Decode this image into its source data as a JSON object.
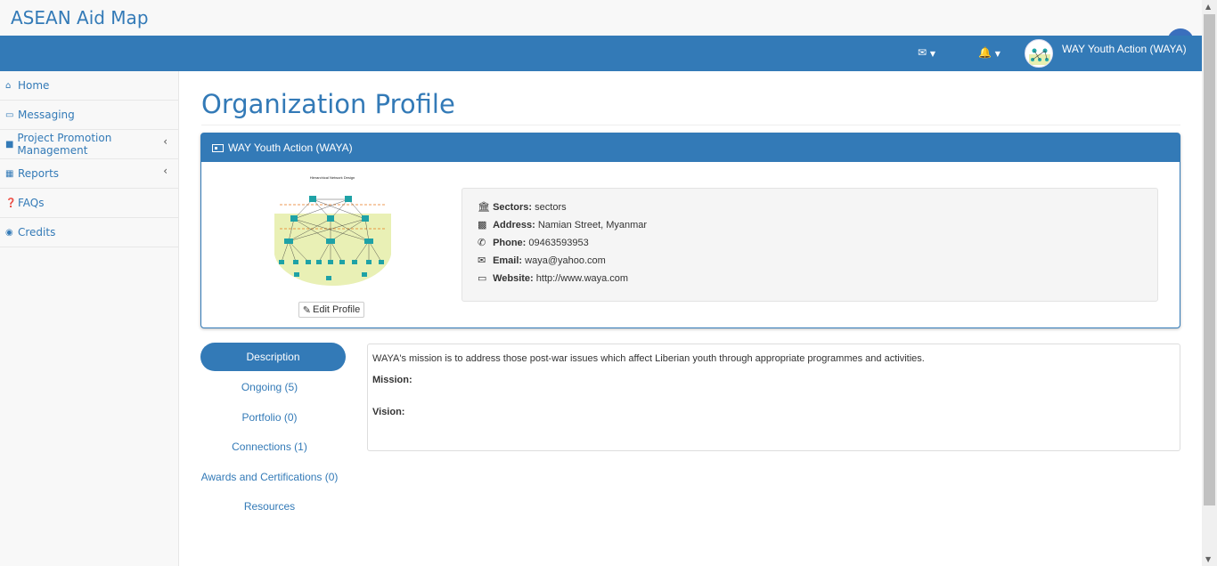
{
  "app": {
    "title": "ASEAN Aid Map"
  },
  "nav": {
    "user_name": "WAY Youth Action (WAYA)"
  },
  "sidebar": {
    "items": [
      {
        "label": "Home",
        "icon": "home-icon"
      },
      {
        "label": "Messaging",
        "icon": "inbox-icon"
      },
      {
        "label": "Project Promotion Management",
        "icon": "book-icon"
      },
      {
        "label": "Reports",
        "icon": "table-icon"
      },
      {
        "label": "FAQs",
        "icon": "question-circle-icon"
      },
      {
        "label": "Credits",
        "icon": "dashboard-icon"
      }
    ]
  },
  "page": {
    "title": "Organization Profile"
  },
  "panel": {
    "heading": "WAY Youth Action (WAYA)",
    "edit_label": "Edit Profile",
    "diagram_title": "Hierarchical Network Design"
  },
  "info": {
    "sectors": {
      "label": "Sectors:",
      "value": "sectors"
    },
    "address": {
      "label": "Address:",
      "value": "Namian Street, Myanmar"
    },
    "phone": {
      "label": "Phone:",
      "value": "09463593953"
    },
    "email": {
      "label": "Email:",
      "value": "waya@yahoo.com"
    },
    "website": {
      "label": "Website:",
      "value": "http://www.waya.com"
    }
  },
  "tabs": {
    "description": "Description",
    "ongoing": "Ongoing (5)",
    "portfolio": "Portfolio (0)",
    "connections": "Connections (1)",
    "awards": "Awards and Certifications (0)",
    "resources": "Resources"
  },
  "description": {
    "text": "WAYA's mission is to address those post-war issues which affect Liberian youth through appropriate programmes and activities.",
    "mission_label": "Mission:",
    "vision_label": "Vision:"
  },
  "colors": {
    "brand": "#337ab7",
    "nav": "#337ab7"
  }
}
